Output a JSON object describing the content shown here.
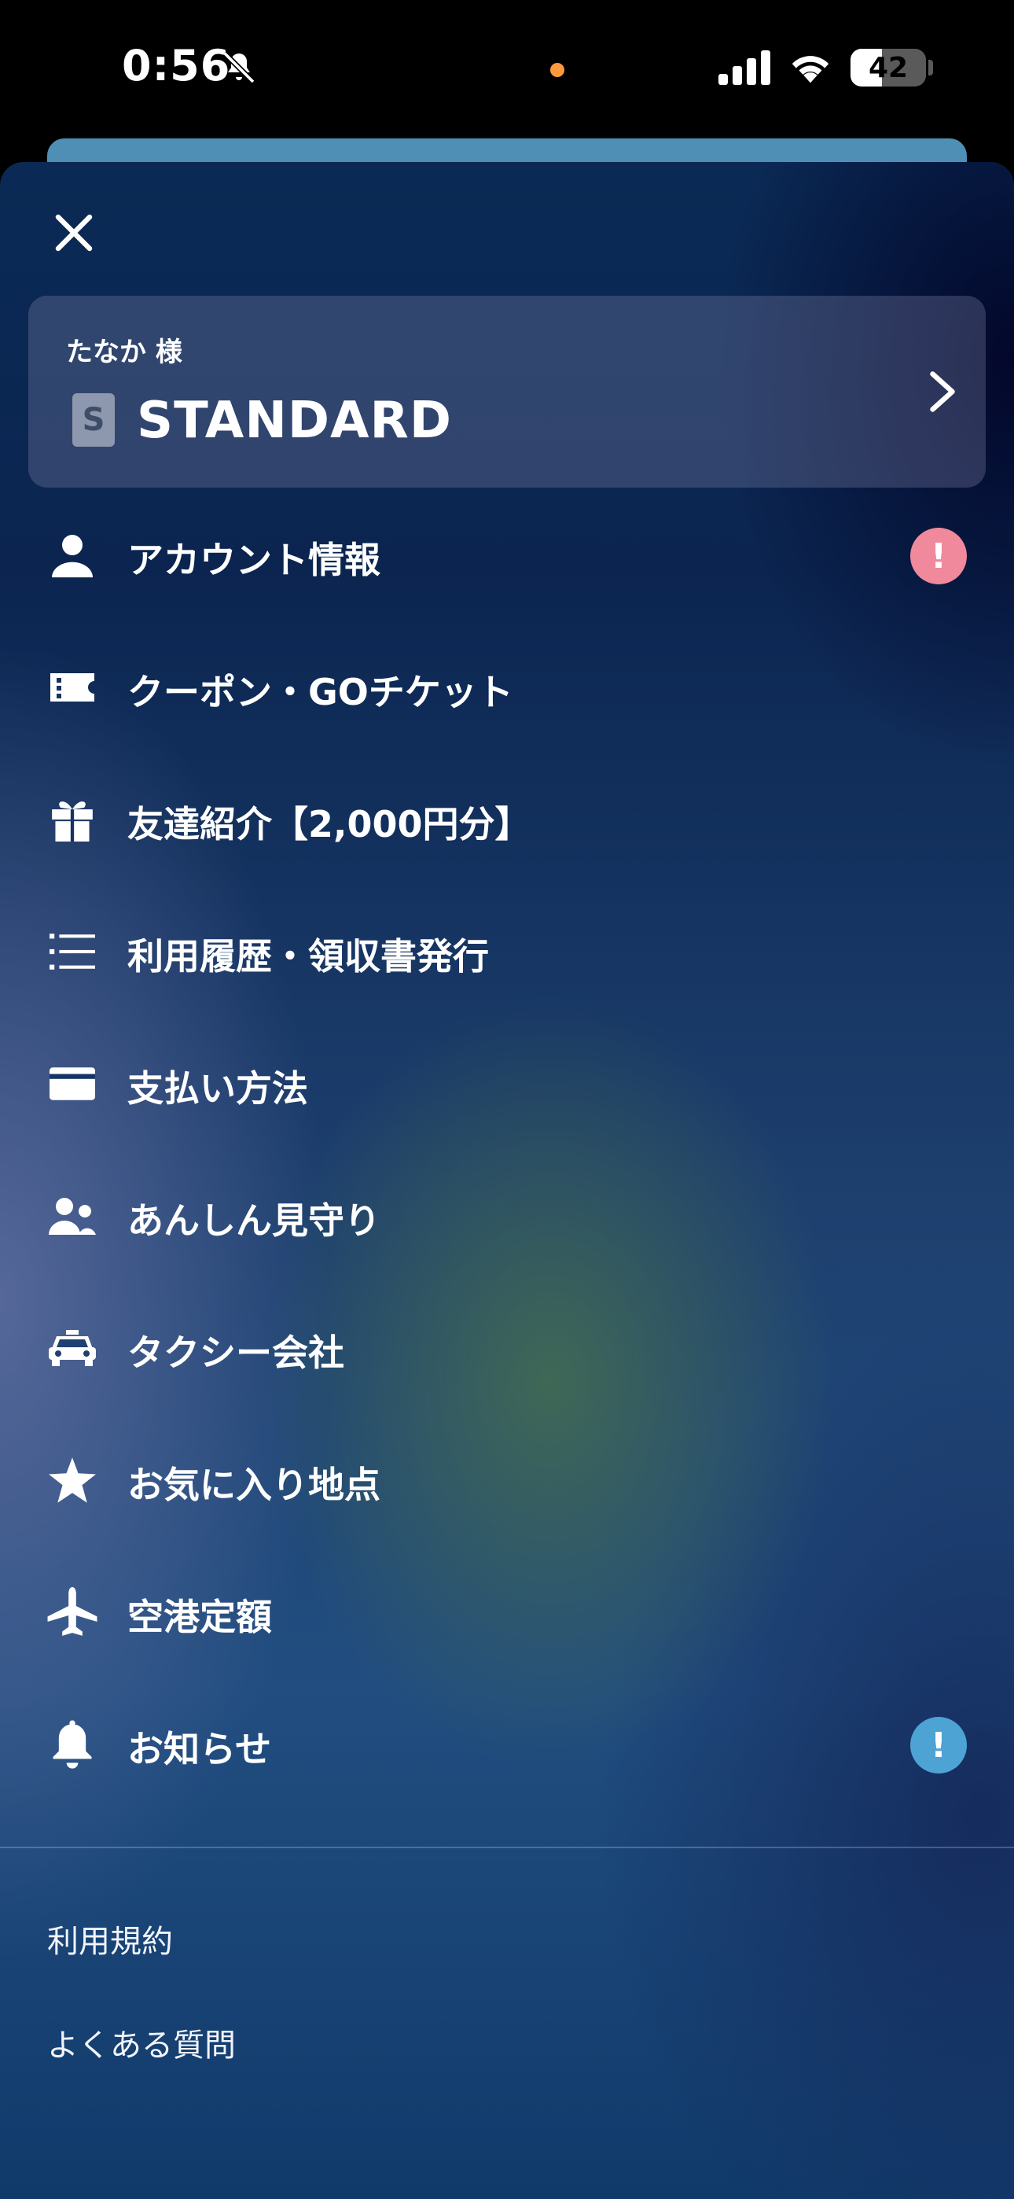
{
  "status_bar": {
    "time": "0:56",
    "battery": "42",
    "battery_level": 0.42
  },
  "drawer": {
    "member_card": {
      "name": "たなか 様",
      "rank_badge": "S",
      "rank": "STANDARD"
    },
    "menu": [
      {
        "label": "アカウント情報",
        "icon": "person-icon",
        "badge": "!",
        "badge_color": "#f0899b"
      },
      {
        "label": "クーポン・GOチケット",
        "icon": "ticket-icon"
      },
      {
        "label": "友達紹介【2,000円分】",
        "icon": "gift-icon"
      },
      {
        "label": "利用履歴・領収書発行",
        "icon": "list-icon"
      },
      {
        "label": "支払い方法",
        "icon": "credit-card-icon"
      },
      {
        "label": "あんしん見守り",
        "icon": "people-icon"
      },
      {
        "label": "タクシー会社",
        "icon": "taxi-icon"
      },
      {
        "label": "お気に入り地点",
        "icon": "star-icon"
      },
      {
        "label": "空港定額",
        "icon": "airplane-icon"
      },
      {
        "label": "お知らせ",
        "icon": "bell-icon",
        "badge": "!",
        "badge_color": "#4da3d4"
      }
    ],
    "footer": {
      "terms": "利用規約",
      "faq": "よくある質問"
    }
  }
}
